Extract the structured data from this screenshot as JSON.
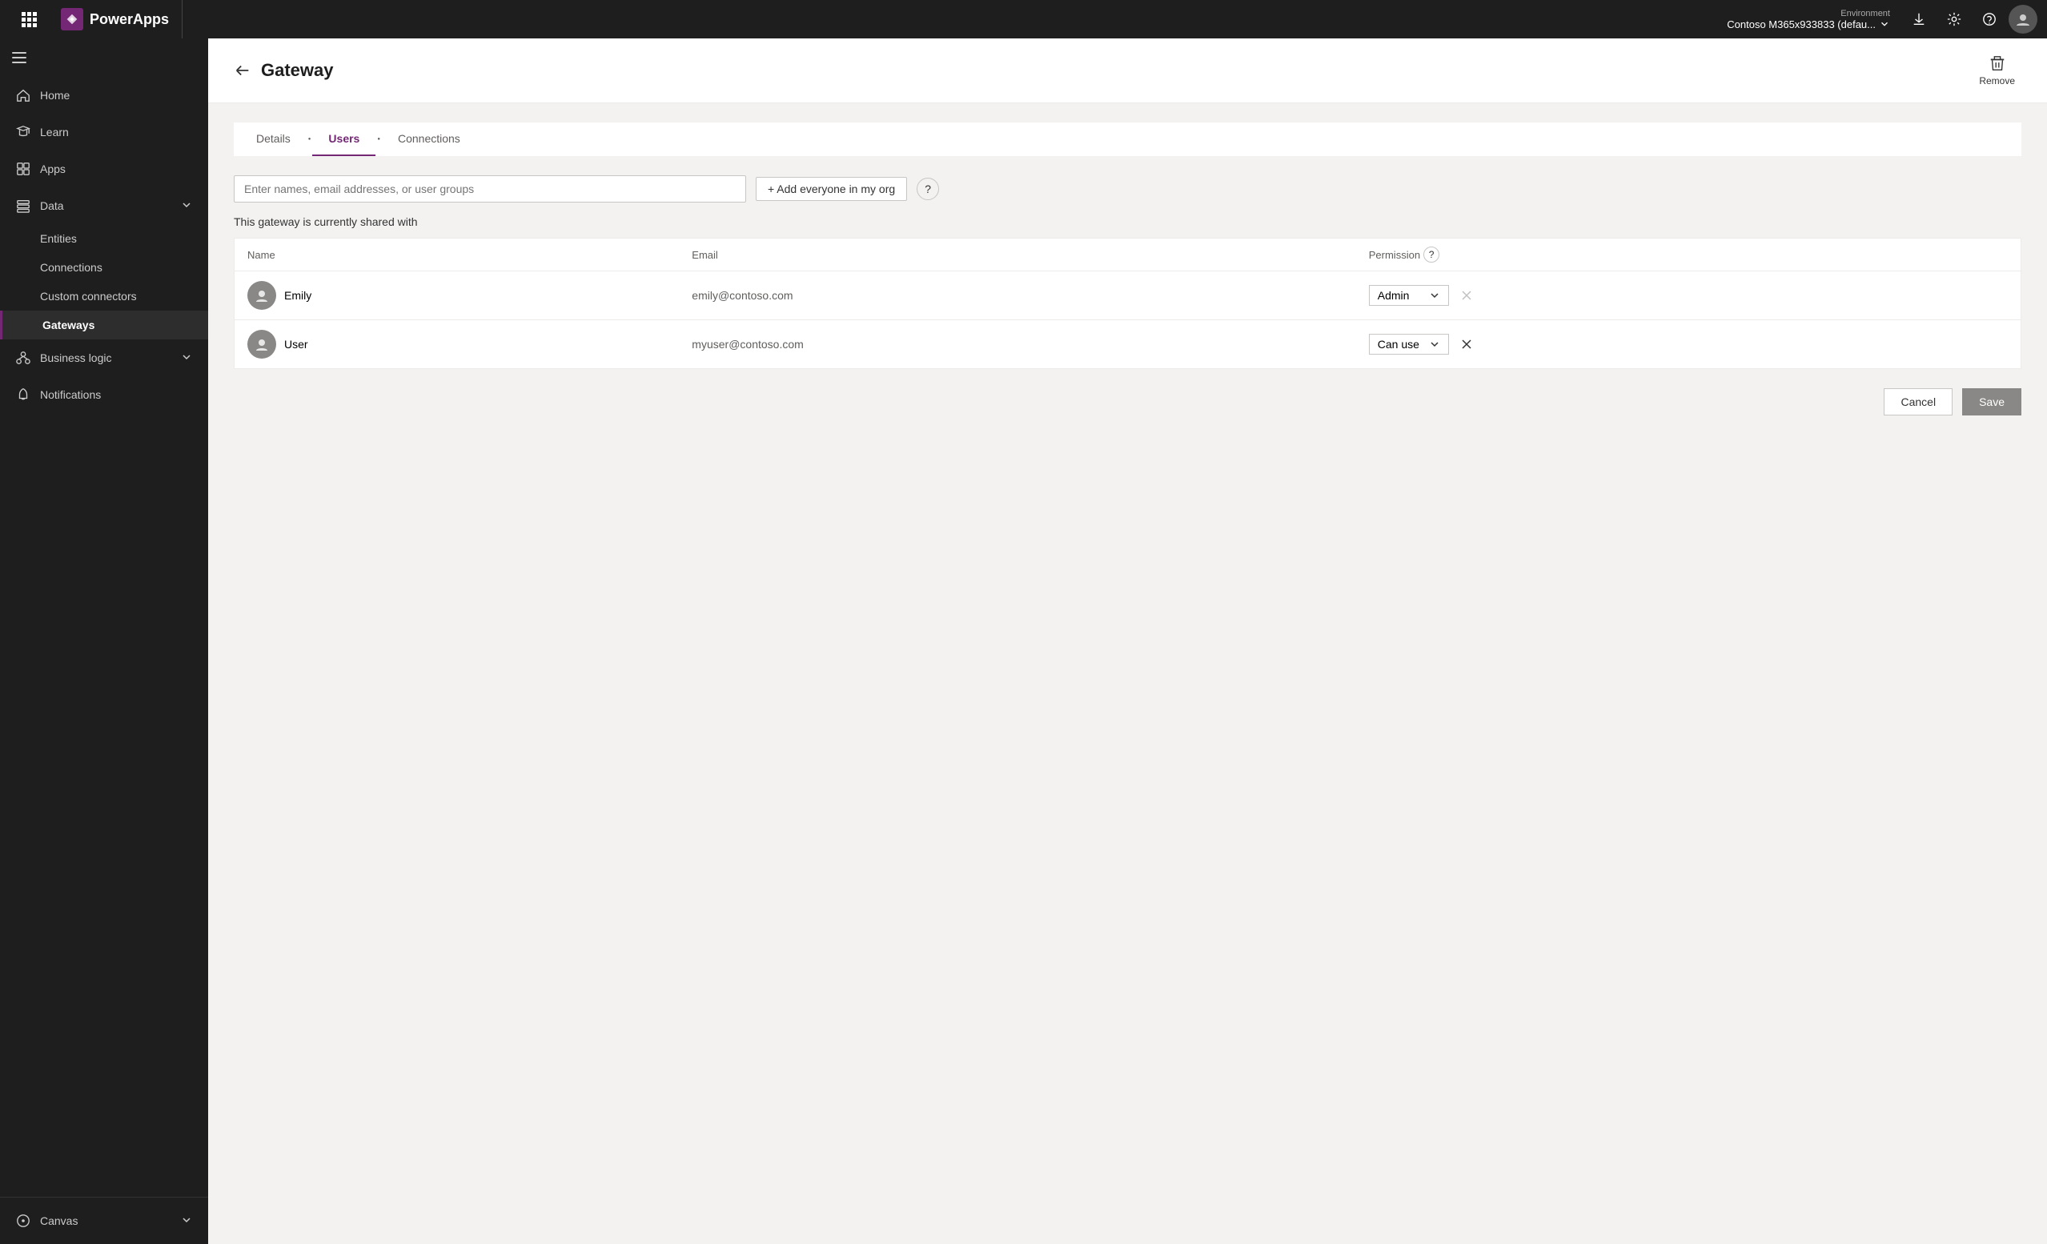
{
  "topbar": {
    "logo_text": "PowerApps",
    "env_label": "Environment",
    "env_name": "Contoso M365x933833 (defau...",
    "download_icon": "download-icon",
    "settings_icon": "settings-icon",
    "help_icon": "help-icon"
  },
  "sidebar": {
    "collapse_icon": "menu-icon",
    "items": [
      {
        "id": "home",
        "label": "Home",
        "icon": "home-icon",
        "active": false
      },
      {
        "id": "learn",
        "label": "Learn",
        "icon": "learn-icon",
        "active": false
      },
      {
        "id": "apps",
        "label": "Apps",
        "icon": "apps-icon",
        "active": false
      },
      {
        "id": "data",
        "label": "Data",
        "icon": "data-icon",
        "active": false,
        "has_chevron": true
      }
    ],
    "subitems": [
      {
        "id": "entities",
        "label": "Entities",
        "active": false
      },
      {
        "id": "connections",
        "label": "Connections",
        "active": false
      },
      {
        "id": "custom-connectors",
        "label": "Custom connectors",
        "active": false
      },
      {
        "id": "gateways",
        "label": "Gateways",
        "active": true
      }
    ],
    "bottom_items": [
      {
        "id": "business-logic",
        "label": "Business logic",
        "icon": "business-logic-icon",
        "has_chevron": true
      },
      {
        "id": "notifications",
        "label": "Notifications",
        "icon": "notifications-icon"
      }
    ],
    "canvas": {
      "label": "Canvas",
      "icon": "canvas-icon",
      "has_chevron": true
    }
  },
  "page": {
    "title": "Gateway",
    "back_label": "back",
    "remove_label": "Remove"
  },
  "tabs": [
    {
      "id": "details",
      "label": "Details",
      "active": false
    },
    {
      "id": "users",
      "label": "Users",
      "active": true
    },
    {
      "id": "connections",
      "label": "Connections",
      "active": false
    }
  ],
  "users_section": {
    "search_placeholder": "Enter names, email addresses, or user groups",
    "add_everyone_label": "+ Add everyone in my org",
    "shared_with_text": "This gateway is currently shared with",
    "table": {
      "columns": [
        "Name",
        "Email",
        "Permission"
      ],
      "rows": [
        {
          "name": "Emily",
          "email": "emily@contoso.com",
          "permission": "Admin",
          "removable": false
        },
        {
          "name": "User",
          "email": "myuser@contoso.com",
          "permission": "Can use",
          "removable": true
        }
      ]
    },
    "cancel_label": "Cancel",
    "save_label": "Save"
  }
}
